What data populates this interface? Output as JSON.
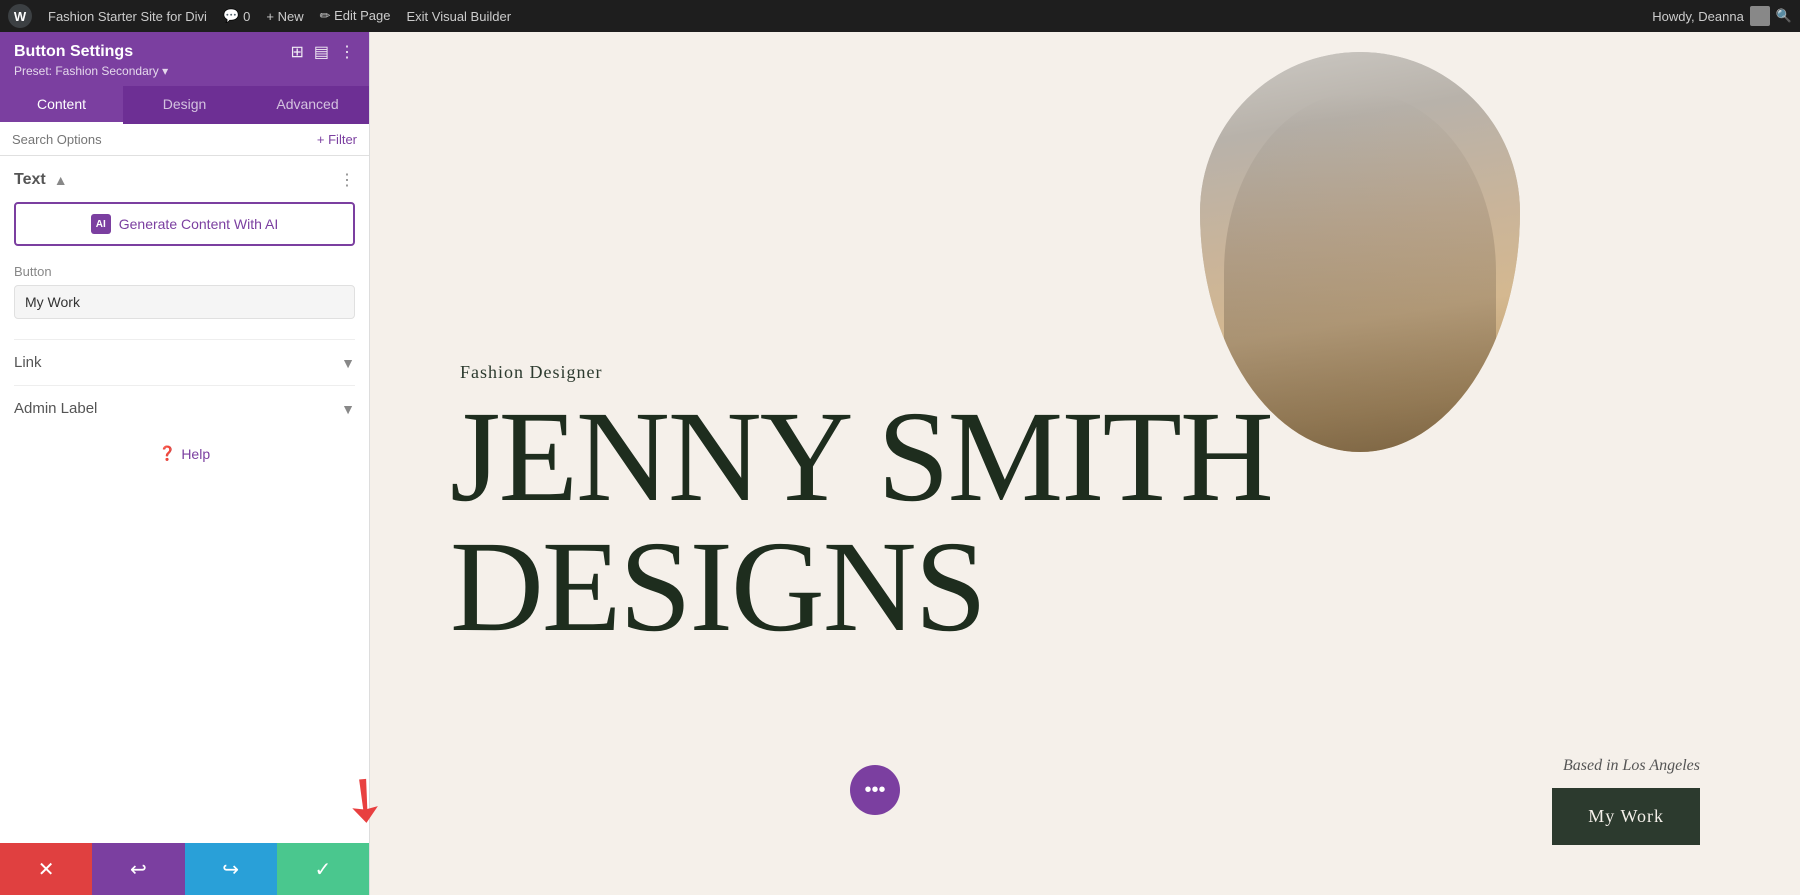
{
  "admin_bar": {
    "wp_label": "W",
    "site_name": "Fashion Starter Site for Divi",
    "comment_icon": "💬",
    "comment_count": "0",
    "new_label": "+ New",
    "edit_page_label": "✏ Edit Page",
    "exit_vb_label": "Exit Visual Builder",
    "howdy_label": "Howdy, Deanna",
    "search_icon": "🔍"
  },
  "panel": {
    "title": "Button Settings",
    "preset": "Preset: Fashion Secondary ▾",
    "tabs": [
      "Content",
      "Design",
      "Advanced"
    ],
    "active_tab": "Content",
    "search_placeholder": "Search Options",
    "filter_label": "+ Filter",
    "section_text_label": "Text",
    "generate_btn_label": "Generate Content With AI",
    "button_field_label": "Button",
    "button_field_value": "My Work",
    "link_section_label": "Link",
    "admin_label_section": "Admin Label",
    "help_label": "Help"
  },
  "bottom_bar": {
    "cancel_label": "✕",
    "undo_label": "↩",
    "redo_label": "↪",
    "save_label": "✓"
  },
  "canvas": {
    "fashion_designer_label": "Fashion Designer",
    "hero_name_line1": "JENNY SMITH",
    "hero_name_line2": "DESIGNS",
    "based_in": "Based in Los Angeles",
    "my_work_btn": "My Work",
    "dots_label": "•••"
  }
}
